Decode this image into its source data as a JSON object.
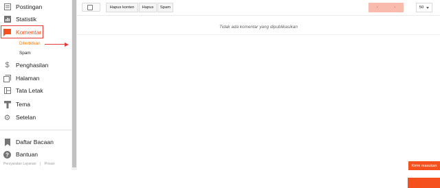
{
  "sidebar": {
    "items": [
      {
        "label": "Postingan",
        "icon": "posts-icon"
      },
      {
        "label": "Statistik",
        "icon": "stats-icon"
      },
      {
        "label": "Komentar",
        "icon": "comment-icon"
      },
      {
        "label": "Penghasilan",
        "icon": "dollar-icon"
      },
      {
        "label": "Halaman",
        "icon": "pages-icon"
      },
      {
        "label": "Tata Letak",
        "icon": "layout-icon"
      },
      {
        "label": "Tema",
        "icon": "paint-roller-icon"
      },
      {
        "label": "Setelan",
        "icon": "gear-icon"
      },
      {
        "label": "Daftar Bacaan",
        "icon": "bookmark-icon"
      },
      {
        "label": "Bantuan",
        "icon": "help-icon"
      }
    ],
    "sub_items": [
      {
        "label": "Diterbitkan",
        "active": true
      },
      {
        "label": "Spam",
        "active": false
      }
    ],
    "footer": [
      "Persyaratan Layanan",
      "|",
      "Privasi"
    ]
  },
  "toolbar": {
    "buttons": [
      "Hapus konten",
      "Hapus",
      "Spam"
    ],
    "pager": [
      "‹",
      "›"
    ],
    "per_page": "50"
  },
  "main": {
    "empty_message": "Tidak ada komentar yang dipublikasikan"
  },
  "feedback_button": "Kirim masukan",
  "colors": {
    "accent": "#f57c00",
    "highlight": "#e53935",
    "pager": "#f8bbad"
  }
}
